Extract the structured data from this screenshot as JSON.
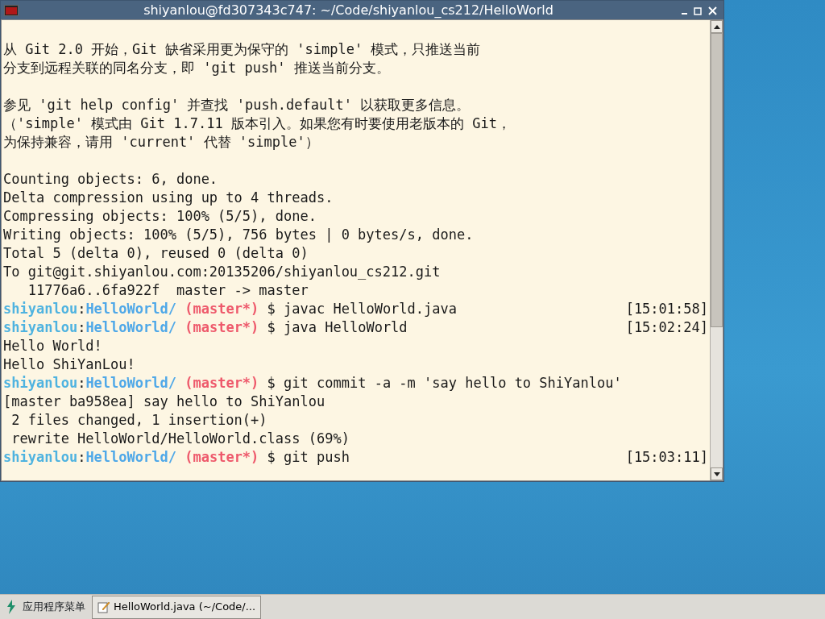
{
  "window": {
    "title": "shiyanlou@fd307343c747: ~/Code/shiyanlou_cs212/HelloWorld"
  },
  "terminal": {
    "lines": [
      {
        "kind": "blank"
      },
      {
        "kind": "text",
        "text": "从 Git 2.0 开始，Git 缺省采用更为保守的 'simple' 模式，只推送当前"
      },
      {
        "kind": "text",
        "text": "分支到远程关联的同名分支，即 'git push' 推送当前分支。"
      },
      {
        "kind": "blank"
      },
      {
        "kind": "text",
        "text": "参见 'git help config' 并查找 'push.default' 以获取更多信息。"
      },
      {
        "kind": "text",
        "text": "（'simple' 模式由 Git 1.7.11 版本引入。如果您有时要使用老版本的 Git，"
      },
      {
        "kind": "text",
        "text": "为保持兼容，请用 'current' 代替 'simple'）"
      },
      {
        "kind": "blank"
      },
      {
        "kind": "text",
        "text": "Counting objects: 6, done."
      },
      {
        "kind": "text",
        "text": "Delta compression using up to 4 threads."
      },
      {
        "kind": "text",
        "text": "Compressing objects: 100% (5/5), done."
      },
      {
        "kind": "text",
        "text": "Writing objects: 100% (5/5), 756 bytes | 0 bytes/s, done."
      },
      {
        "kind": "text",
        "text": "Total 5 (delta 0), reused 0 (delta 0)"
      },
      {
        "kind": "text",
        "text": "To git@git.shiyanlou.com:20135206/shiyanlou_cs212.git"
      },
      {
        "kind": "text",
        "text": "   11776a6..6fa922f  master -> master"
      },
      {
        "kind": "prompt",
        "user": "shiyanlou",
        "sep": ":",
        "path": "HelloWorld/",
        "branch": "(master*)",
        "command": "$ javac HelloWorld.java",
        "time": "[15:01:58]"
      },
      {
        "kind": "prompt",
        "user": "shiyanlou",
        "sep": ":",
        "path": "HelloWorld/",
        "branch": "(master*)",
        "command": "$ java HelloWorld",
        "time": "[15:02:24]"
      },
      {
        "kind": "text",
        "text": "Hello World!"
      },
      {
        "kind": "text",
        "text": "Hello ShiYanLou!"
      },
      {
        "kind": "prompt",
        "user": "shiyanlou",
        "sep": ":",
        "path": "HelloWorld/",
        "branch": "(master*)",
        "command": "$ git commit -a -m 'say hello to ShiYanlou'"
      },
      {
        "kind": "text",
        "text": "[master ba958ea] say hello to ShiYanlou"
      },
      {
        "kind": "text",
        "text": " 2 files changed, 1 insertion(+)"
      },
      {
        "kind": "text",
        "text": " rewrite HelloWorld/HelloWorld.class (69%)"
      },
      {
        "kind": "prompt",
        "user": "shiyanlou",
        "sep": ":",
        "path": "HelloWorld/",
        "branch": "(master*)",
        "command": "$ git push",
        "time": "[15:03:11]"
      }
    ]
  },
  "taskbar": {
    "menu_label": "应用程序菜单",
    "tasks": [
      {
        "label": "HelloWorld.java (~/Code/..."
      }
    ]
  }
}
